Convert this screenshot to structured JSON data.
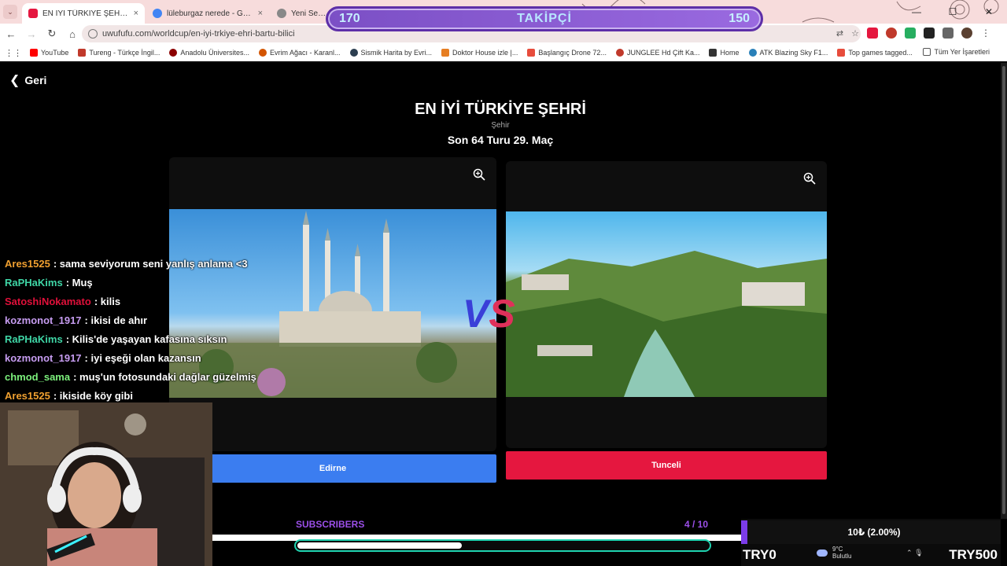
{
  "browser": {
    "tabs": [
      {
        "title": "EN İYİ TÜRKİYE ŞEHRİ | UwUFUFU",
        "close": "×",
        "color": "#e5173f"
      },
      {
        "title": "lüleburgaz nerede - Google'da",
        "close": "×",
        "color": "#4285f4"
      },
      {
        "title": "Yeni Sekme",
        "close": "",
        "color": "#888888"
      }
    ],
    "address": "uwufufu.com/worldcup/en-iyi-trkiye-ehri-bartu-bilici",
    "bookmarks": [
      {
        "label": "YouTube",
        "color": "#ff0000"
      },
      {
        "label": "Tureng - Türkçe İngil...",
        "color": "#c0392b"
      },
      {
        "label": "Anadolu Üniversites...",
        "color": "#8b0000"
      },
      {
        "label": "Evrim Ağacı - Karanl...",
        "color": "#d35400"
      },
      {
        "label": "Sismik Harita by Evri...",
        "color": "#2c3e50"
      },
      {
        "label": "Doktor House izle |...",
        "color": "#e67e22"
      },
      {
        "label": "Başlangıç Drone 72...",
        "color": "#e74c3c"
      },
      {
        "label": "JUNGLEE Hd Çift Ka...",
        "color": "#c0392b"
      },
      {
        "label": "Home",
        "color": "#333333"
      },
      {
        "label": "ATK Blazing Sky F1...",
        "color": "#2980b9"
      },
      {
        "label": "Top games tagged...",
        "color": "#e74c3c"
      }
    ],
    "bookmarks_all": "Tüm Yer İşaretleri"
  },
  "follower_goal": {
    "start": "170",
    "label": "TAKİPÇİ",
    "end": "150"
  },
  "page": {
    "back_label": "Geri",
    "title": "EN İYİ TÜRKİYE ŞEHRİ",
    "category": "Şehir",
    "round": "Son 64 Turu 29. Maç",
    "vs_v": "V",
    "vs_s": "S",
    "left_choice": "Edirne",
    "right_choice": "Tunceli"
  },
  "chat": [
    {
      "user": "Ares1525",
      "color": "#f0a030",
      "text": ": sama seviyorum seni yanlış anlama <3"
    },
    {
      "user": "RaPHaKims",
      "color": "#3fd6a6",
      "text": ": Muş"
    },
    {
      "user": "SatoshiNokamato",
      "color": "#e0103a",
      "text": ": kilis"
    },
    {
      "user": "kozmonot_1917",
      "color": "#c69cf0",
      "text": ": ikisi de ahır"
    },
    {
      "user": "RaPHaKims",
      "color": "#3fd6a6",
      "text": ": Kilis'de yaşayan kafasına sıksın"
    },
    {
      "user": "kozmonot_1917",
      "color": "#c69cf0",
      "text": ": iyi eşeği olan kazansın"
    },
    {
      "user": "chmod_sama",
      "color": "#7cf07c",
      "text": ": muş'un fotosundaki dağlar güzelmiş"
    },
    {
      "user": "Ares1525",
      "color": "#f0a030",
      "text": ": ikiside köy gibi"
    }
  ],
  "subscribers": {
    "label": "SUBSCRIBERS",
    "count": "4 / 10",
    "progress": 0.4
  },
  "donation": {
    "status": "10₺ (2.00%)",
    "min": "TRY0",
    "max": "TRY500"
  },
  "weather": {
    "temp": "9°C",
    "condition": "Bulutlu"
  }
}
